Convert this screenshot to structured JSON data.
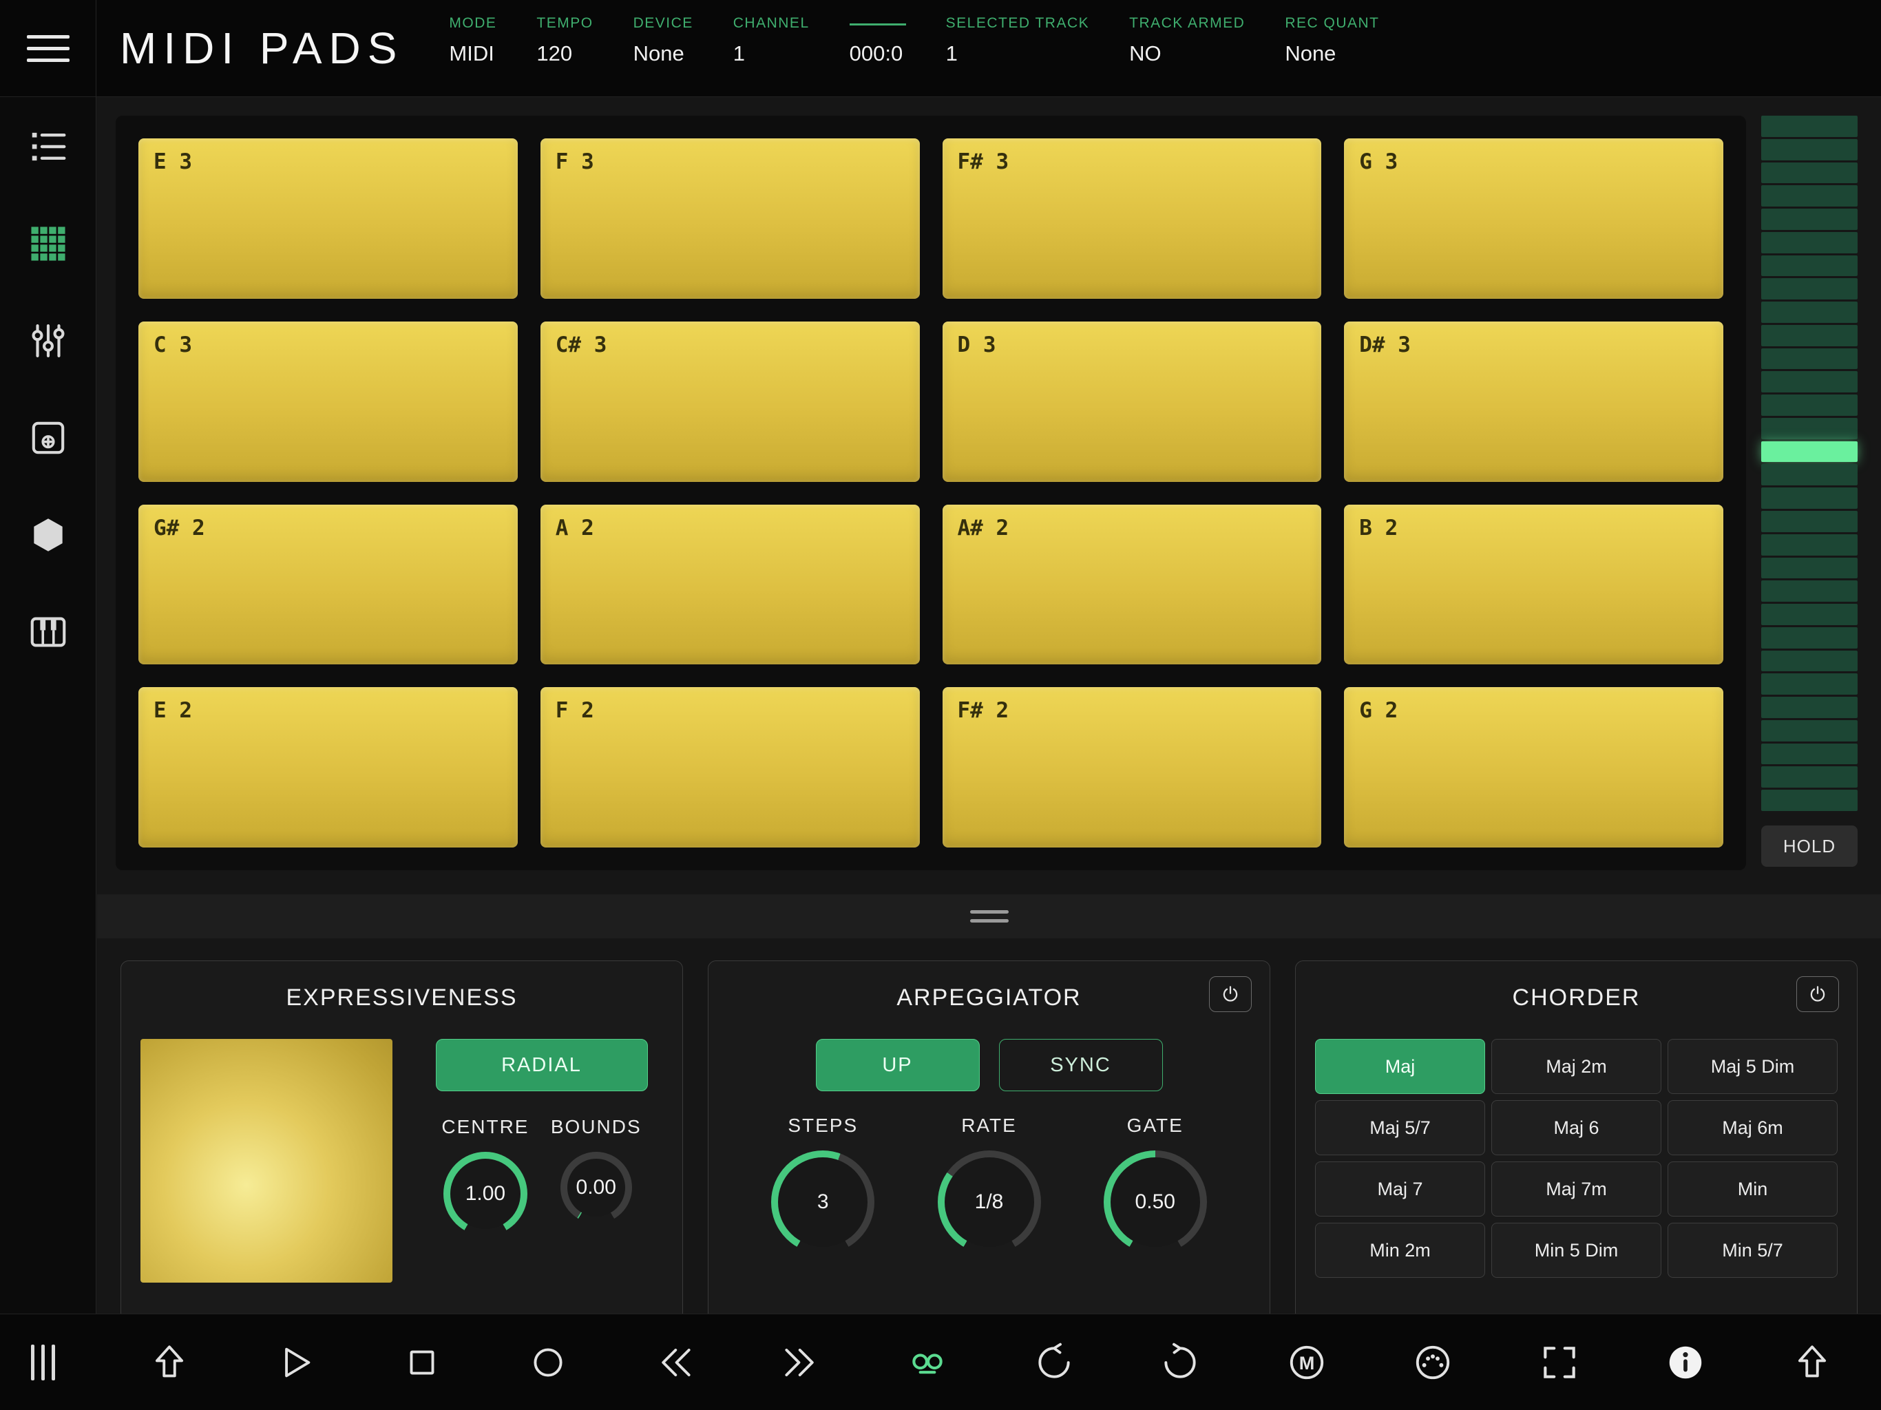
{
  "colors": {
    "accent_green": "#3fae6e",
    "button_green": "#2e9d62",
    "meter_active": "#6af09e",
    "pad_yellow": "#e6cd4d"
  },
  "header": {
    "title": "MIDI PADS",
    "fields": [
      {
        "name": "mode",
        "label": "MODE",
        "value": "MIDI"
      },
      {
        "name": "tempo",
        "label": "TEMPO",
        "value": "120"
      },
      {
        "name": "device",
        "label": "DEVICE",
        "value": "None"
      },
      {
        "name": "channel",
        "label": "CHANNEL",
        "value": "1"
      },
      {
        "name": "transport-position",
        "label": "",
        "line": true,
        "value": "000:0"
      },
      {
        "name": "selected-track",
        "label": "SELECTED TRACK",
        "value": "1"
      },
      {
        "name": "track-armed",
        "label": "TRACK ARMED",
        "value": "NO"
      },
      {
        "name": "rec-quant",
        "label": "REC QUANT",
        "value": "None"
      }
    ]
  },
  "sidebar": {
    "items": [
      {
        "icon": "list",
        "active": false
      },
      {
        "icon": "pads-grid",
        "active": true
      },
      {
        "icon": "mixer",
        "active": false
      },
      {
        "icon": "modules",
        "active": false
      },
      {
        "icon": "hexagon",
        "active": false
      },
      {
        "icon": "keyboard",
        "active": false
      }
    ]
  },
  "pads": {
    "rows": [
      [
        "E 3",
        "F 3",
        "F# 3",
        "G 3"
      ],
      [
        "C 3",
        "C# 3",
        "D 3",
        "D# 3"
      ],
      [
        "G# 2",
        "A 2",
        "A# 2",
        "B 2"
      ],
      [
        "E 2",
        "F 2",
        "F# 2",
        "G 2"
      ]
    ]
  },
  "meter": {
    "segment_count": 30,
    "active_index": 14,
    "hold_label": "HOLD"
  },
  "panels": {
    "expressiveness": {
      "title": "EXPRESSIVENESS",
      "mode_button": "RADIAL",
      "knobs": [
        {
          "label": "CENTRE",
          "value": "1.00",
          "arc": 300
        },
        {
          "label": "BOUNDS",
          "value": "0.00",
          "arc": 2
        }
      ]
    },
    "arpeggiator": {
      "title": "ARPEGGIATOR",
      "direction_button": "UP",
      "sync_button": "SYNC",
      "knobs": [
        {
          "label": "STEPS",
          "value": "3",
          "arc": 170
        },
        {
          "label": "RATE",
          "value": "1/8",
          "arc": 95
        },
        {
          "label": "GATE",
          "value": "0.50",
          "arc": 150
        }
      ]
    },
    "chorder": {
      "title": "CHORDER",
      "selected": "Maj",
      "chords": [
        [
          "Maj",
          "Maj 2m",
          "Maj 5 Dim"
        ],
        [
          "Maj 5/7",
          "Maj 6",
          "Maj 6m"
        ],
        [
          "Maj 7",
          "Maj 7m",
          "Min"
        ],
        [
          "Min 2m",
          "Min 5 Dim",
          "Min 5/7"
        ]
      ]
    }
  },
  "toolbar": {
    "items": [
      "sidebar-handle",
      "import-arrow",
      "play",
      "stop",
      "record",
      "rewind",
      "fast-forward",
      "loop-record",
      "undo",
      "redo",
      "metronome",
      "midi-connector",
      "fullscreen",
      "info",
      "share-arrow"
    ]
  }
}
